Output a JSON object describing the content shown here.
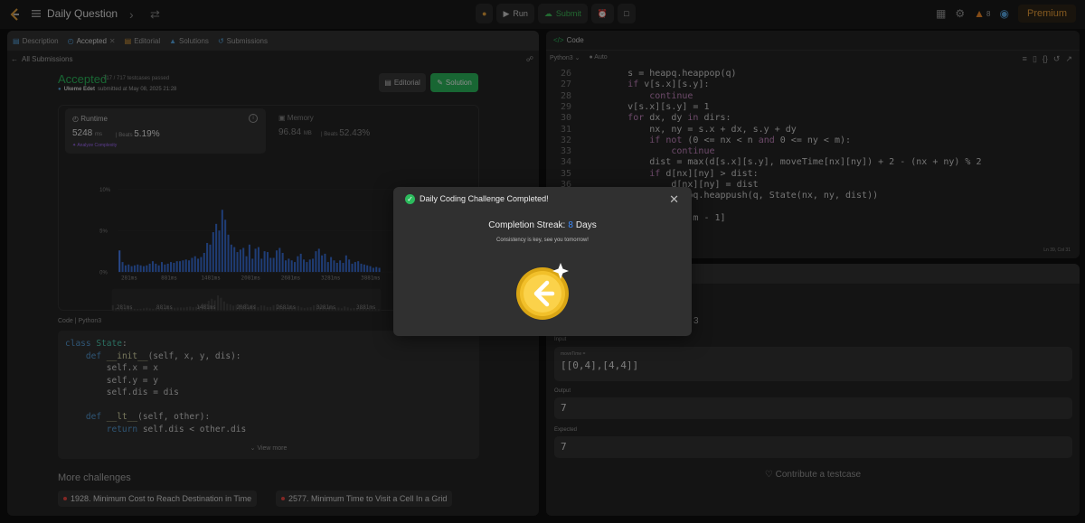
{
  "topbar": {
    "title": "Daily Question",
    "run_label": "Run",
    "submit_label": "Submit",
    "streak_count": "8",
    "premium_label": "Premium"
  },
  "left": {
    "tabs": [
      "Description",
      "Accepted",
      "Editorial",
      "Solutions",
      "Submissions"
    ],
    "back_label": "All Submissions",
    "status": "Accepted",
    "passed": "717 / 717 testcases passed",
    "user": "Ukeme Edet",
    "submitted": "submitted at May 08, 2025 21:28",
    "editorial_btn": "Editorial",
    "solution_btn": "Solution",
    "runtime_label": "Runtime",
    "runtime_value": "5248",
    "runtime_unit": "ms",
    "beats_label": "Beats",
    "runtime_beats": "5.19%",
    "complexity_label": "Analyze Complexity",
    "memory_label": "Memory",
    "memory_value": "96.84",
    "memory_unit": "MB",
    "memory_beats": "52.43%",
    "code_label": "Code",
    "code_lang": "Python3",
    "code_lines": [
      "class State:",
      "    def __init__(self, x, y, dis):",
      "        self.x = x",
      "        self.y = y",
      "        self.dis = dis",
      "",
      "    def __lt__(self, other):",
      "        return self.dis < other.dis"
    ],
    "view_more": "View more",
    "more_title": "More challenges",
    "challenges": [
      "1928. Minimum Cost to Reach Destination in Time",
      "2577. Minimum Time to Visit a Cell In a Grid"
    ]
  },
  "chart_data": {
    "type": "bar",
    "yticks": [
      "10%",
      "5%",
      "0%"
    ],
    "xticks": [
      "281ms",
      "881ms",
      "1481ms",
      "2081ms",
      "2681ms",
      "3281ms",
      "3881ms"
    ],
    "ylim": [
      0,
      10
    ],
    "values": [
      2.6,
      1.2,
      0.8,
      0.9,
      0.7,
      0.8,
      0.9,
      0.8,
      0.7,
      0.8,
      1.0,
      1.3,
      1.0,
      0.8,
      1.2,
      0.9,
      1.0,
      1.2,
      1.1,
      1.3,
      1.3,
      1.4,
      1.5,
      1.4,
      1.7,
      1.9,
      1.6,
      1.8,
      2.3,
      3.5,
      3.3,
      4.8,
      5.8,
      5.0,
      7.5,
      6.3,
      4.5,
      3.3,
      3.0,
      2.4,
      2.7,
      2.9,
      1.9,
      3.3,
      1.6,
      2.8,
      3.0,
      1.6,
      2.5,
      2.4,
      1.7,
      1.7,
      2.6,
      2.9,
      2.3,
      1.4,
      1.6,
      1.4,
      1.2,
      1.9,
      2.2,
      1.5,
      1.2,
      1.5,
      1.6,
      2.5,
      2.8,
      2.0,
      2.2,
      1.2,
      1.8,
      1.4,
      1.1,
      1.4,
      1.1,
      2.0,
      1.5,
      1.0,
      1.2,
      1.3,
      1.0,
      0.9,
      0.8,
      0.7,
      0.5,
      0.6,
      0.5
    ],
    "highlight_index": 0,
    "bar_color": "#3a6fd8",
    "highlight_color": "#4a86ff"
  },
  "right": {
    "code_tab": "Code",
    "lang": "Python3",
    "auto": "Auto",
    "cursor": "Ln 39, Col 31",
    "lines": [
      {
        "n": "26",
        "t": "        s = heapq.heappop(q)"
      },
      {
        "n": "27",
        "t": "        if v[s.x][s.y]:"
      },
      {
        "n": "28",
        "t": "            continue"
      },
      {
        "n": "29",
        "t": "        v[s.x][s.y] = 1"
      },
      {
        "n": "30",
        "t": "        for dx, dy in dirs:"
      },
      {
        "n": "31",
        "t": "            nx, ny = s.x + dx, s.y + dy"
      },
      {
        "n": "32",
        "t": "            if not (0 <= nx < n and 0 <= ny < m):"
      },
      {
        "n": "33",
        "t": "                continue"
      },
      {
        "n": "34",
        "t": "            dist = max(d[s.x][s.y], moveTime[nx][ny]) + 2 - (nx + ny) % 2"
      },
      {
        "n": "35",
        "t": "            if d[nx][ny] > dist:"
      },
      {
        "n": "36",
        "t": "                d[nx][ny] = dist"
      },
      {
        "n": "37",
        "t": "                heapq.heappush(q, State(nx, ny, dist))"
      },
      {
        "n": "38",
        "t": ""
      },
      {
        "n": "39",
        "t": "    return d[n - 1][m - 1]"
      }
    ],
    "partial_digit": "3",
    "input_label": "Input",
    "var_label": "moveTime =",
    "input_value": "[[0,4],[4,4]]",
    "output_label": "Output",
    "output_value": "7",
    "expected_label": "Expected",
    "expected_value": "7",
    "contribute": "Contribute a testcase"
  },
  "modal": {
    "title": "Daily Coding Challenge Completed!",
    "streak_label": "Completion Streak:",
    "streak_value": "8",
    "streak_unit": "Days",
    "subtitle": "Consistency is key, see you tomorrow!"
  }
}
